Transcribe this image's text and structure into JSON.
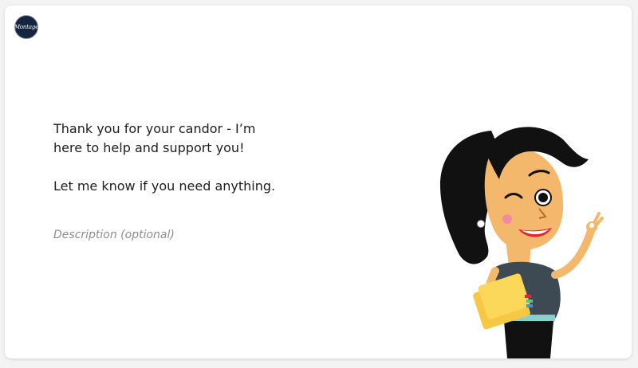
{
  "logo": {
    "text": "Montage",
    "bg_color": "#13253f"
  },
  "message": {
    "line1": "Thank you for your candor - I’m here to help and support you!",
    "line2": "Let me know if you need anything."
  },
  "description": {
    "placeholder": "Description (optional)"
  },
  "character": {
    "icon": "winking-woman-character",
    "hair_color": "#111111",
    "skin_color": "#f3b86b",
    "shirt_color": "#3d4a54",
    "folder_color": "#f7c843"
  }
}
